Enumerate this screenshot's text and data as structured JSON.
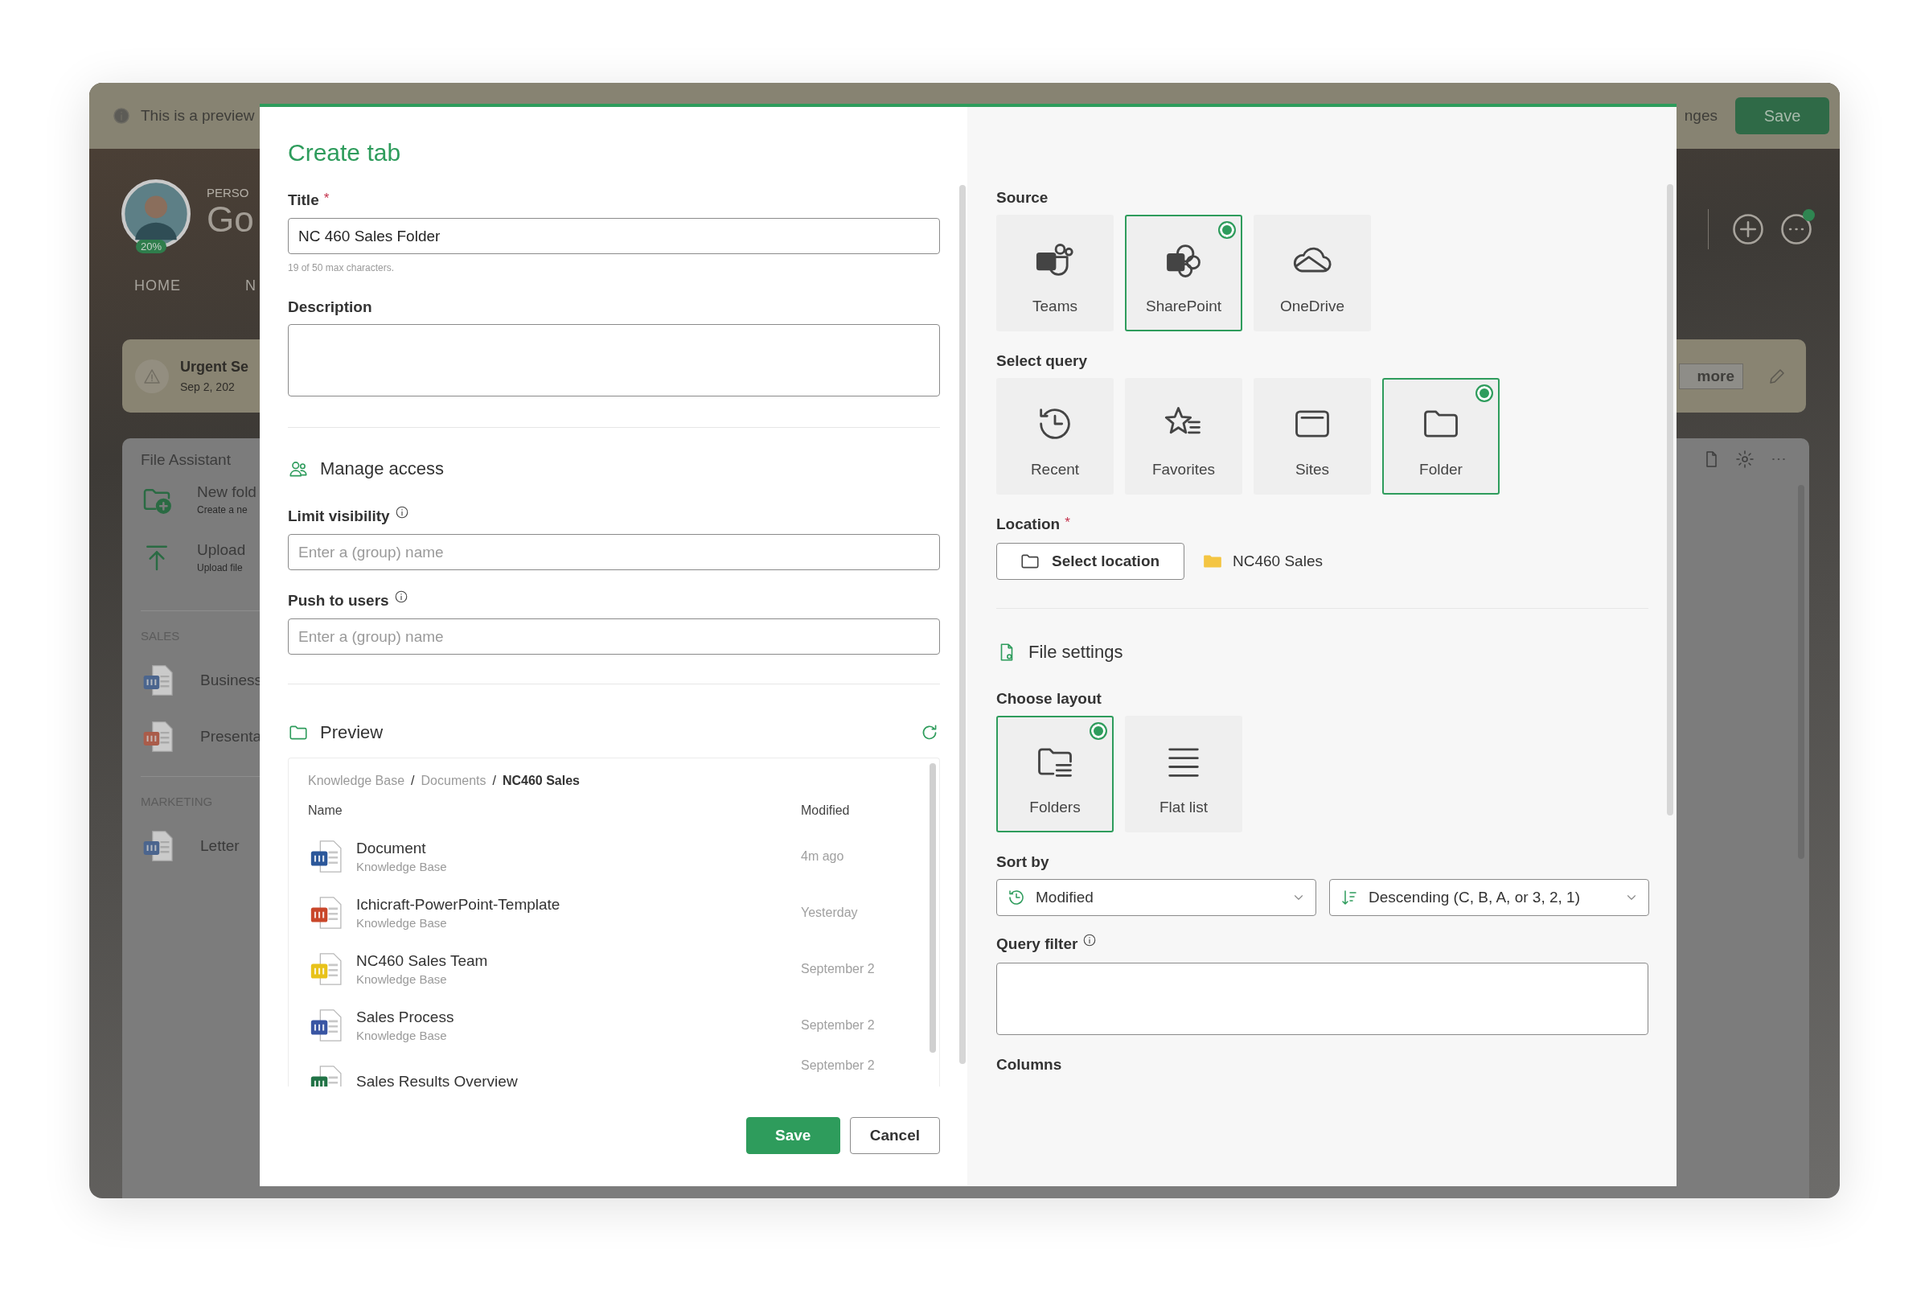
{
  "app": {
    "banner": {
      "text": "This is a preview",
      "text_end": "nges",
      "save_label": "Save"
    },
    "profile": {
      "badge": "20%",
      "label": "PERSO",
      "name": "Go"
    },
    "nav": [
      "HOME",
      "N"
    ],
    "alert": {
      "title": "Urgent Se",
      "date": "Sep 2, 202",
      "button_label": "more"
    },
    "file_assistant": {
      "title": "File Assistant",
      "actions": [
        {
          "kind": "new-folder",
          "title": "New fold",
          "subtitle": "Create a ne"
        },
        {
          "kind": "upload",
          "title": "Upload",
          "subtitle": "Upload file"
        }
      ],
      "groups": [
        {
          "name": "SALES",
          "items": [
            {
              "kind": "word",
              "name": "Business"
            },
            {
              "kind": "powerpoint",
              "name": "Presenta"
            }
          ]
        },
        {
          "name": "MARKETING",
          "items": [
            {
              "kind": "word",
              "name": "Letter"
            }
          ]
        }
      ]
    }
  },
  "dialog": {
    "title": "Create tab",
    "title_field": {
      "label": "Title",
      "required_mark": "*",
      "value": "NC 460 Sales Folder",
      "hint": "19 of 50 max characters."
    },
    "description_field": {
      "label": "Description"
    },
    "manage_access": {
      "heading": "Manage access",
      "fields": [
        {
          "label": "Limit visibility",
          "placeholder": "Enter a (group) name"
        },
        {
          "label": "Push to users",
          "placeholder": "Enter a (group) name"
        }
      ]
    },
    "preview": {
      "heading": "Preview",
      "separator": "/",
      "breadcrumb": [
        {
          "label": "Knowledge Base",
          "current": false
        },
        {
          "label": "Documents",
          "current": false
        },
        {
          "label": "NC460 Sales",
          "current": true
        }
      ],
      "columns": [
        "Name",
        "Modified"
      ],
      "rows": [
        {
          "kind": "word",
          "name": "Document",
          "location": "Knowledge Base",
          "modified": "4m ago"
        },
        {
          "kind": "powerpoint",
          "name": "Ichicraft-PowerPoint-Template",
          "location": "Knowledge Base",
          "modified": "Yesterday"
        },
        {
          "kind": "powerbi",
          "name": "NC460 Sales Team",
          "location": "Knowledge Base",
          "modified": "September 2"
        },
        {
          "kind": "visio",
          "name": "Sales Process",
          "location": "Knowledge Base",
          "modified": "September 2"
        },
        {
          "kind": "excel",
          "name": "Sales Results Overview",
          "modified": "September 2"
        }
      ]
    },
    "buttons": [
      {
        "label": "Save",
        "primary": true
      },
      {
        "label": "Cancel",
        "primary": false
      }
    ],
    "source": {
      "label": "Source",
      "options": [
        {
          "kind": "teams",
          "label": "Teams",
          "selected": false
        },
        {
          "kind": "sharepoint",
          "label": "SharePoint",
          "selected": true
        },
        {
          "kind": "onedrive",
          "label": "OneDrive",
          "selected": false
        }
      ]
    },
    "query": {
      "label": "Select query",
      "options": [
        {
          "kind": "recent",
          "label": "Recent",
          "selected": false
        },
        {
          "kind": "favorites",
          "label": "Favorites",
          "selected": false
        },
        {
          "kind": "sites",
          "label": "Sites",
          "selected": false
        },
        {
          "kind": "folder",
          "label": "Folder",
          "selected": true
        }
      ]
    },
    "location": {
      "label": "Location",
      "required_mark": "*",
      "button_label": "Select location",
      "value": "NC460 Sales"
    },
    "file_settings": {
      "heading": "File settings"
    },
    "layout": {
      "label": "Choose layout",
      "options": [
        {
          "kind": "folders",
          "label": "Folders",
          "selected": true
        },
        {
          "kind": "flat",
          "label": "Flat list",
          "selected": false
        }
      ]
    },
    "sort": {
      "label": "Sort by",
      "dropdowns": [
        {
          "kind": "field",
          "value": "Modified"
        },
        {
          "kind": "order",
          "value": "Descending (C, B, A, or 3, 2, 1)"
        }
      ]
    },
    "query_filter": {
      "label": "Query filter"
    },
    "columns": {
      "label": "Columns"
    }
  }
}
